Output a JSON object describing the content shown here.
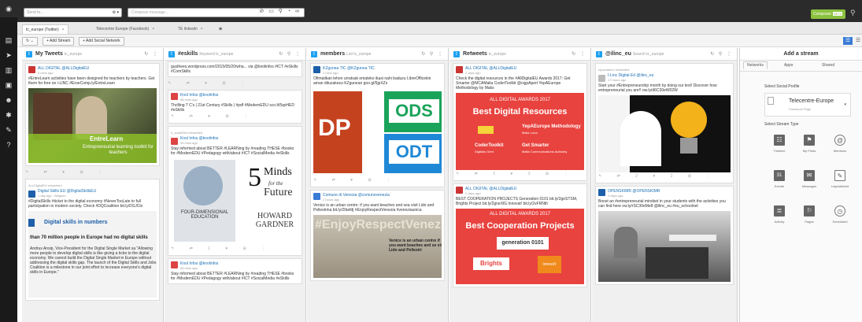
{
  "topbar": {
    "sendto_placeholder": "Send to...",
    "compose_placeholder": "Compose message...",
    "compose_tools": "⊘ ▭ ⚲ ◔ ∞",
    "composer_label": "Composer",
    "composer_badge": "BETA"
  },
  "tabs": [
    {
      "label": "tc_europe (Twitter)"
    },
    {
      "label": "Telecentre Europe (Facebook)"
    },
    {
      "label": "TE linkedin"
    }
  ],
  "toolbar": {
    "refresh": "↻ ⌄",
    "add_stream": "+ Add Stream",
    "add_network": "+ Add Social Network"
  },
  "streams": [
    {
      "title": "My Tweets",
      "sub": "tc_europe",
      "cards": [
        {
          "name": "ALL DIGITAL @ALLDigitalEU",
          "time": "5 mins ago",
          "text": "#EntreLearn activities have been designed for teachers by teachers. Get them for free on i-LINC #EroeComp.ly/EntreLearn",
          "img_title": "EntreLearn",
          "img_sub": "Entrepreneurial learning toolkit for teachers"
        },
        {
          "retweet": "ALLDigitalEU retweeted",
          "name": "Digital Skills EU @DigitalSkillsEU",
          "time": "1 day ago · Belgium",
          "text": "#DigitalSkills #ticket to the digital economy #NeverTooLate to full participation in modern society. Check #DQCoalition bit.ly/DSJCtx",
          "img_title": "Digital skills in numbers",
          "img_sub": "than 70 million people in Europe had no digital skills",
          "quote": "Andrus Ansip, Vice-President for the Digital Single Market sa \"Allowing more people to develop digital skills is like giving a ticke to the digital economy. We cannot build the Digital Single Market in Europe without addressing the digital skills gap. The launch of the Digital Skills and Jobs Coalition is a milestone in our joint effort to increase everyone's digital skills in Europe.\""
        }
      ]
    },
    {
      "title": "#eskills",
      "sub": "Keyword tc_europe",
      "cards": [
        {
          "text": "gusthees.wordpress.com/2015/05/20/wha... via @knolinfos #ICT #eSkills #ComSkills"
        },
        {
          "name": "Knol Infos @knolinfos",
          "time": "58 mins ago",
          "text": "Thrilling 7 C's | 21st Century #Skills | #pdf #ModernEDU sco.lt/5qsHED #eSkills"
        },
        {
          "retweet": "h_sozaField retweeted",
          "name": "Knol Infos @knolinfos",
          "time": "59 mins ago",
          "text": "Stay informed about BETTER #LEARNing by #reading THESE #books for #ModernEDU #Pedagogy with/about #ICT #SocialMedia #eSkills",
          "book1": "FOUR-DIMENSIONAL EDUCATION",
          "book2_num": "5",
          "book2_a": "Minds",
          "book2_b": "for the",
          "book2_c": "Future",
          "book2_author": "HOWARD GARDNER"
        },
        {
          "name": "Knol Infos @knolinfos",
          "time": "58 mins ago",
          "text": "Stay informed about BETTER #LEARNing by #reading THESE #books for #ModernEDU #Pedagogy with/about #ICT #SocialMedia #eSkills"
        }
      ]
    },
    {
      "title": "members",
      "sub": "List tc_europe",
      "cards": [
        {
          "name": "KZgunea TIC @KZgunea TIC",
          "time": "2 mins ago",
          "text": "Ofimatikan lehen urratsak emateko ikasi nahi baduzu LibreOfficekin aman dituzakezu KZgunean goo.gl/5jpXZs",
          "ods": "ODS",
          "odt": "ODT",
          "odp": "DP"
        },
        {
          "name": "Comune di Venezia @comunevenezia",
          "time": "2 hours ago",
          "text": "Venice is an urban centre: if you want beaches and sea visit Lido and Pellestrina bit.ly/2Ibefdj #EnjoyRespectVenezia #veneziaunica",
          "img_title": "#EnjoyRespectVenezia",
          "img_sub": "Venice is an urban centre if you want beaches and se visit Lido and Pellestri"
        }
      ]
    },
    {
      "title": "Retweets",
      "sub": "tc_europe",
      "cards": [
        {
          "name": "ALL DIGITAL @ALLDigitalEU",
          "time": "2 days ago",
          "text": "Check the digital resources in the #AllDigitalEU Awards 2017: Get Smarter @MCAMalia CoderToolkit @cigpApert YepAEurope Methodology by Maks",
          "award_head": "ALL DIGITAL AWARDS 2017",
          "award_title": "Best Digital Resources",
          "r1": "YepAEurope Methodology",
          "r1s": "Maks Luna",
          "r2": "CoderToolkit",
          "r2s": "Digitalis Gent",
          "r3": "Get Smarter",
          "r3s": "Malta Communications Authority",
          "counts": "3   ♥ 3"
        },
        {
          "name": "ALL DIGITAL @ALLDigitalEU",
          "time": "2 days ago",
          "text": "BEST COOPERATION PROJECTS Generation 0101 bit.ly/2geSTSM, Brights Project bit.ly/2gneXlG Innovat! bit.ly/2vFRNth",
          "award_head": "ALL DIGITAL AWARDS 2017",
          "award_title": "Best Cooperation Projects",
          "p1": "generation 0101",
          "p2": "Brights",
          "p3": "innova't"
        }
      ]
    },
    {
      "title": "@ilinc_eu",
      "sub": "Search tc_europe",
      "cards": [
        {
          "retweet": "mjcantarino retweeted",
          "name": "I-Linc Digital Ed @ilinc_eu",
          "time": "17 hours ago",
          "text": "Start your #Entrepreneurship month by doing our test! Discover how entrepreneurial you are!! ow.ly/d6C30eW02W",
          "counts": "2   ♥ 2"
        },
        {
          "name": "OPENSKIMR @OPENSKIMR",
          "time": "2 days ago",
          "text": "Boost an #entrepreneurial mindset in your students with the activities you can find here ow.ly/rSC30eMe8 @ilinc_eu #eu_schoolnet"
        }
      ]
    }
  ],
  "addstream": {
    "title": "Add a stream",
    "tabs": [
      "Networks",
      "Apps",
      "Shared"
    ],
    "select_profile": "Select Social Profile",
    "profile_name": "Telecentre-Europe",
    "profile_type": "Facebook Page",
    "select_type": "Select Stream Type",
    "types": [
      {
        "label": "Timeline",
        "icon": "timeline-icon",
        "glyph": "☷"
      },
      {
        "label": "My Posts",
        "icon": "my-posts-icon",
        "glyph": "⚑"
      },
      {
        "label": "Mentions",
        "icon": "mentions-icon",
        "glyph": "@"
      },
      {
        "label": "Events",
        "icon": "events-icon",
        "glyph": "31"
      },
      {
        "label": "Messages",
        "icon": "messages-icon",
        "glyph": "✉"
      },
      {
        "label": "Unpublished",
        "icon": "unpublished-icon",
        "glyph": "✎"
      },
      {
        "label": "Activity",
        "icon": "activity-icon",
        "glyph": "≣"
      },
      {
        "label": "Pages",
        "icon": "pages-icon",
        "glyph": "⚐"
      },
      {
        "label": "Scheduled",
        "icon": "scheduled-icon",
        "glyph": "◷"
      }
    ]
  },
  "colors": {
    "accent": "#1da1f2",
    "composer": "#8cc13f",
    "award_bg": "#e8433f",
    "dark": "#1a1a1a"
  }
}
